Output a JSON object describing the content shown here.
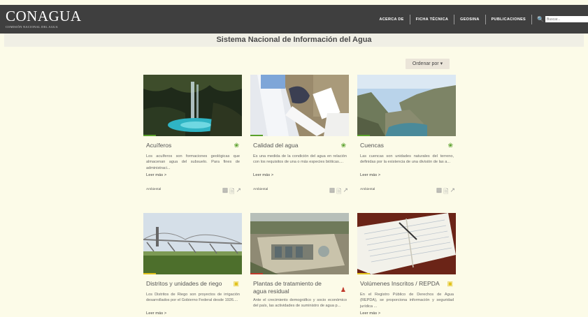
{
  "header": {
    "logo_text": "CONAGUA",
    "logo_subtitle": "COMISIÓN NACIONAL DEL AGUA",
    "nav": [
      "ACERCA DE",
      "FICHA TÉCNICA",
      "GEOSINA",
      "PUBLICACIONES"
    ],
    "search_placeholder": "Buscar..."
  },
  "page_title": "Sistema Nacional de Información del Agua",
  "order_button": "Ordenar por",
  "cards": [
    {
      "title": "Acuíferos",
      "description": "Los acuíferos son formaciones geológicas que almacenan agua del subsuelo. Para fines de administraci...",
      "more": "Leer más >",
      "tag": "Ambiental",
      "category_icon": "leaf-icon",
      "accent": "#5aa02c"
    },
    {
      "title": "Calidad del agua",
      "description": "Es una medida de la condición del agua en relación con los requisitos de una o más especies bióticas....",
      "more": "Leer más >",
      "tag": "Ambiental",
      "category_icon": "leaf-icon",
      "accent": "#5aa02c"
    },
    {
      "title": "Cuencas",
      "description": "Las cuencas son unidades naturales del terreno, definidas por la existencia de una división de las a...",
      "more": "Leer más >",
      "tag": "Ambiental",
      "category_icon": "leaf-icon",
      "accent": "#5aa02c"
    },
    {
      "title": "Distritos y unidades de riego",
      "description": "Los Distritos de Riego son proyectos de irrigación desarrollados por el Gobierno Federal desde 1926....",
      "more": "Leer más >",
      "tag": "",
      "category_icon": "folder-icon",
      "accent": "#e1c21a"
    },
    {
      "title": "Plantas de tratamiento de agua residual",
      "description": "Ante el crecimiento demográfico y socio económico del país, las actividades de suministro de agua p...",
      "more": "",
      "tag": "",
      "category_icon": "people-icon",
      "accent": "#c0392b"
    },
    {
      "title": "Volúmenes Inscritos / REPDA",
      "description": "En el Registro Público de Derechos de Agua (REPDA), se proporciona información y seguridad jurídica ...",
      "more": "Leer más >",
      "tag": "",
      "category_icon": "folder-icon",
      "accent": "#e1c21a"
    }
  ],
  "colors": {
    "leaf": "#5aa02c",
    "folder": "#e1c21a",
    "people": "#c0392b"
  }
}
